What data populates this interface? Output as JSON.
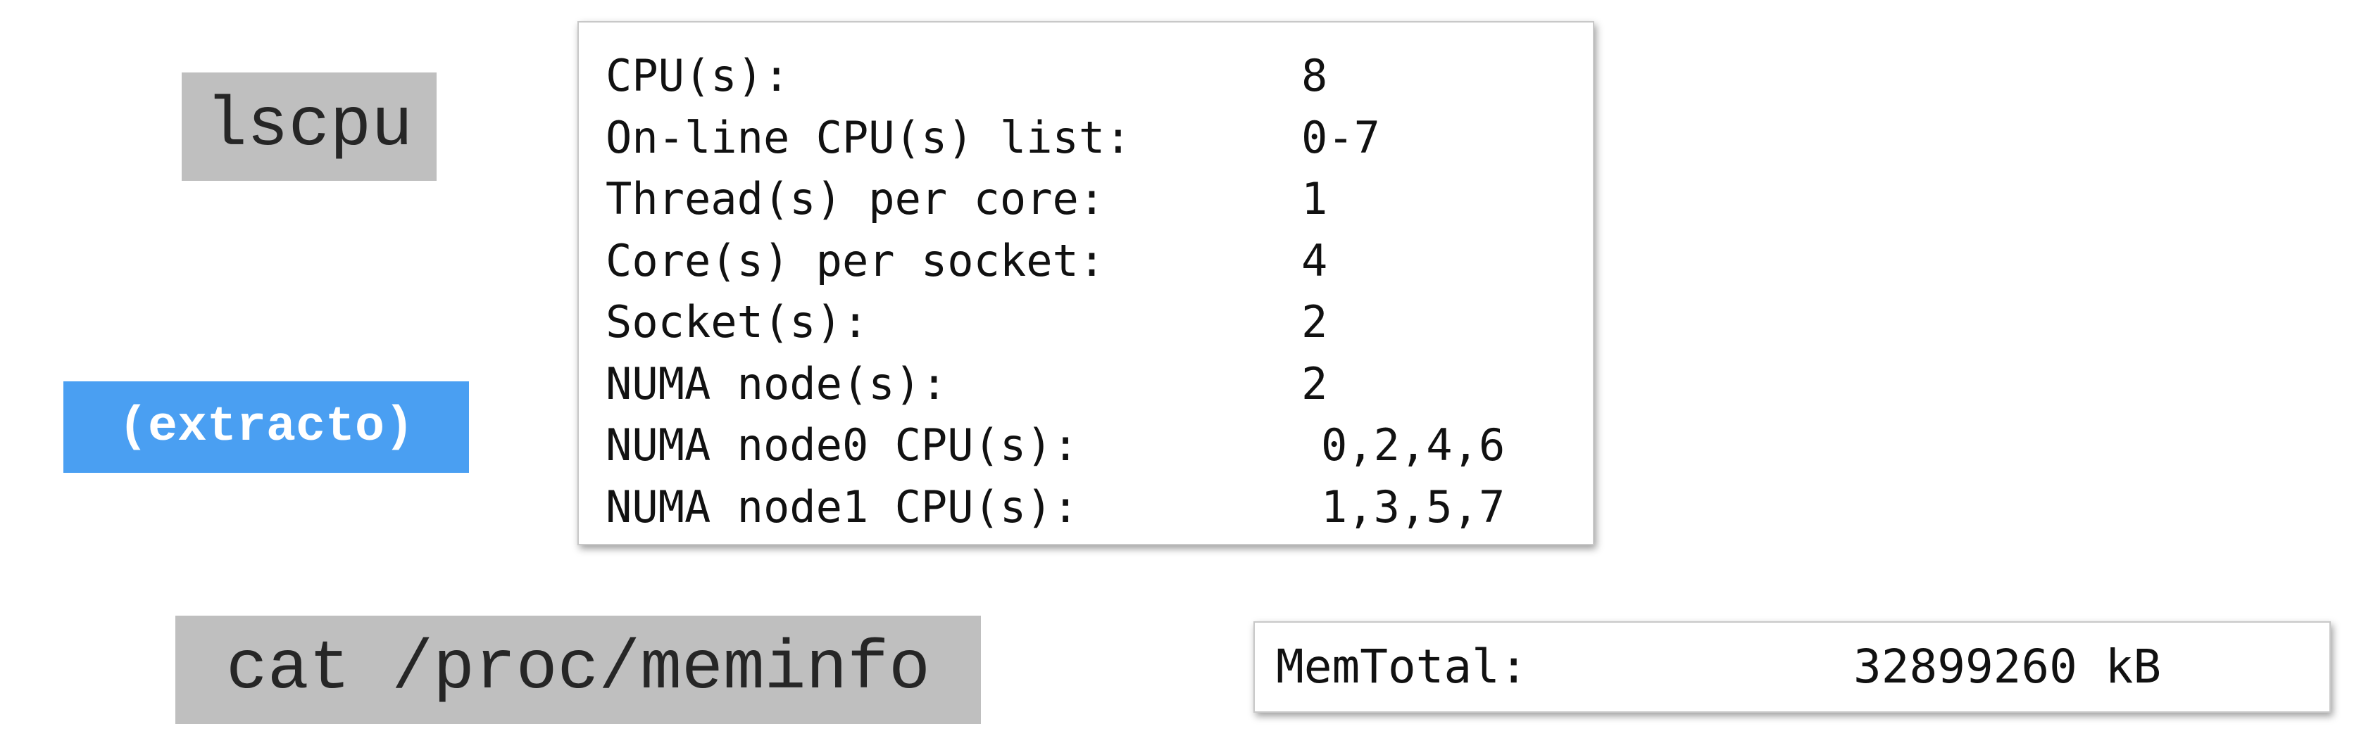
{
  "commands": {
    "lscpu": "lscpu",
    "meminfo": "cat /proc/meminfo"
  },
  "badge": {
    "label": "(extracto)",
    "color": "#4a9ff2"
  },
  "lscpu_output": [
    {
      "key": "CPU(s):",
      "value": "8"
    },
    {
      "key": "On-line CPU(s) list:",
      "value": "0-7"
    },
    {
      "key": "Thread(s) per core:",
      "value": "1"
    },
    {
      "key": "Core(s) per socket:",
      "value": "4"
    },
    {
      "key": "Socket(s):",
      "value": "2"
    },
    {
      "key": "NUMA node(s):",
      "value": "2"
    },
    {
      "key": "NUMA node0 CPU(s):",
      "value": "0,2,4,6"
    },
    {
      "key": "NUMA node1 CPU(s):",
      "value": "1,3,5,7"
    }
  ],
  "meminfo_output": {
    "key": "MemTotal:",
    "value": "32899260 kB"
  }
}
